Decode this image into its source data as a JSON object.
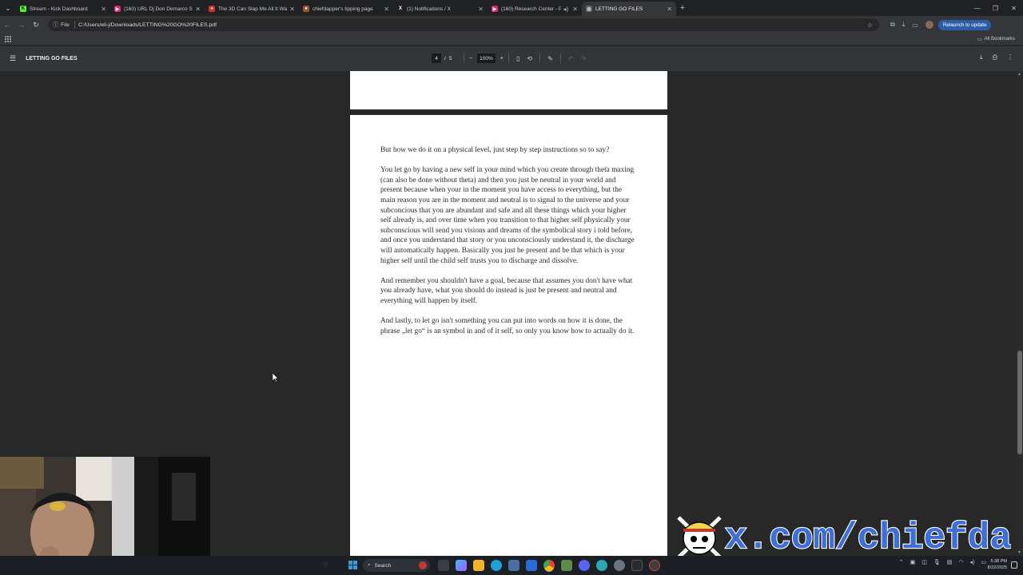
{
  "tabs": [
    {
      "title": "Stream - Kick Dashboard",
      "favicon": "K",
      "color": "#53fc18"
    },
    {
      "title": "(160) URL Dj Don Demarco So",
      "favicon": "▶",
      "color": "#e0245e"
    },
    {
      "title": "The 3D Can Slap Me All It Wan",
      "favicon": "●",
      "color": "#d93025"
    },
    {
      "title": "chiefdapper's tipping page",
      "favicon": "●",
      "color": "#a0522d"
    },
    {
      "title": "(1) Notifications / X",
      "favicon": "X",
      "color": "#222222"
    },
    {
      "title": "(160) Research Center - Po",
      "favicon": "▶",
      "color": "#e0245e"
    },
    {
      "title": "LETTING GO FILES",
      "favicon": "◎",
      "color": "#5f6368"
    }
  ],
  "address": {
    "chip": "File",
    "url": "C:/Users/eli-j/Downloads/LETTING%20GO%20FILES.pdf",
    "relaunch": "Relaunch to update"
  },
  "bookmarks": {
    "all": "All Bookmarks"
  },
  "pdf": {
    "title": "LETTING GO FILES",
    "page_current": "4",
    "page_sep": "/",
    "page_total": "5",
    "zoom": "100%",
    "paragraphs": [
      "But how we do it on a physical level, just step by step instructions so to say?",
      "You let go by having a new self in your mind which you create through theta maxing (can also be done without theta) and then you just be neutral in your world and present because when your in the moment you have access to everything, but the main reason you are in the moment and neutral is to signal to the universe and your subconcious that you are abundant and safe and all these things which your higher self already is, and over time when you transition to that higher self physically your subconscious will send you visions and dreams of the symbolical story i told before, and once you understand that story or you unconsciously understand it, the discharge will automatically happen. Basically you just be present and be that which is your higher self until the child self trusts you to discharge and dissolve.",
      "And remember you shouldn't have a goal, because that assumes you don't have what you already have, what you should do instead is just be present and neutral and everything will happen by itself.",
      "And lastly, to let go isn't something you can put into words on how it is done, the phrase „let go“ is an symbol in and of it self, so only you know how to actually do it."
    ]
  },
  "progress": {
    "scroll_fraction": 0.58
  },
  "taskbar": {
    "search": "Search",
    "time": "5:38 PM",
    "date": "8/22/2025"
  },
  "watermark": {
    "text": "x.com/chiefdapper"
  }
}
